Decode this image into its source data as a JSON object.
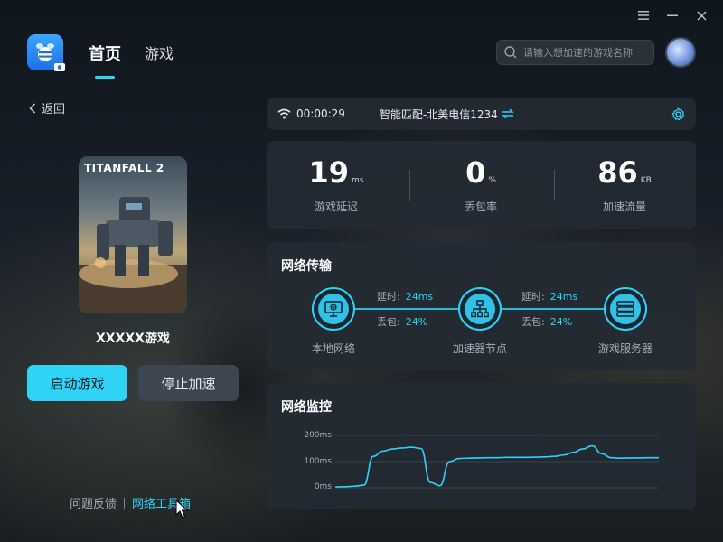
{
  "nav": {
    "home": "首页",
    "games": "游戏"
  },
  "search": {
    "placeholder": "请输入想加速的游戏名称"
  },
  "left": {
    "back": "返回",
    "cover_title": "TITANFALL 2",
    "game_name": "XXXXX游戏",
    "start_button": "启动游戏",
    "stop_button": "停止加速",
    "feedback": "问题反馈",
    "toolbox": "网络工具箱"
  },
  "route": {
    "timer": "00:00:29",
    "route_label": "智能匹配-北美电信1234"
  },
  "stats": [
    {
      "value": "19",
      "unit": "ms",
      "label": "游戏延迟"
    },
    {
      "value": "0",
      "unit": "%",
      "label": "丢包率"
    },
    {
      "value": "86",
      "unit": "KB",
      "label": "加速流量"
    }
  ],
  "network": {
    "title": "网络传输",
    "nodes": [
      {
        "label": "本地网络",
        "icon": "monitor-icon"
      },
      {
        "label": "加速器节点",
        "icon": "network-node-icon"
      },
      {
        "label": "游戏服务器",
        "icon": "server-icon"
      }
    ],
    "links": [
      {
        "latency_label": "延时:",
        "latency": "24ms",
        "loss_label": "丢包:",
        "loss": "24%"
      },
      {
        "latency_label": "延时:",
        "latency": "24ms",
        "loss_label": "丢包:",
        "loss": "24%"
      }
    ]
  },
  "monitor": {
    "title": "网络监控"
  },
  "chart_data": {
    "type": "line",
    "title": "网络监控",
    "yticks": [
      "200ms",
      "100ms",
      "0ms"
    ],
    "ylim": [
      0,
      200
    ],
    "grid": true,
    "series": [
      {
        "values": [
          3,
          4,
          6,
          10,
          120,
          140,
          148,
          152,
          155,
          150,
          20,
          8,
          100,
          112,
          113,
          114,
          115,
          115,
          116,
          116,
          116,
          117,
          118,
          120,
          125,
          135,
          148,
          160,
          130,
          115,
          113,
          114,
          114,
          115,
          115
        ]
      }
    ]
  },
  "colors": {
    "accent": "#2fd4f5",
    "panel": "#242a33",
    "stop_button": "#3c4550"
  }
}
